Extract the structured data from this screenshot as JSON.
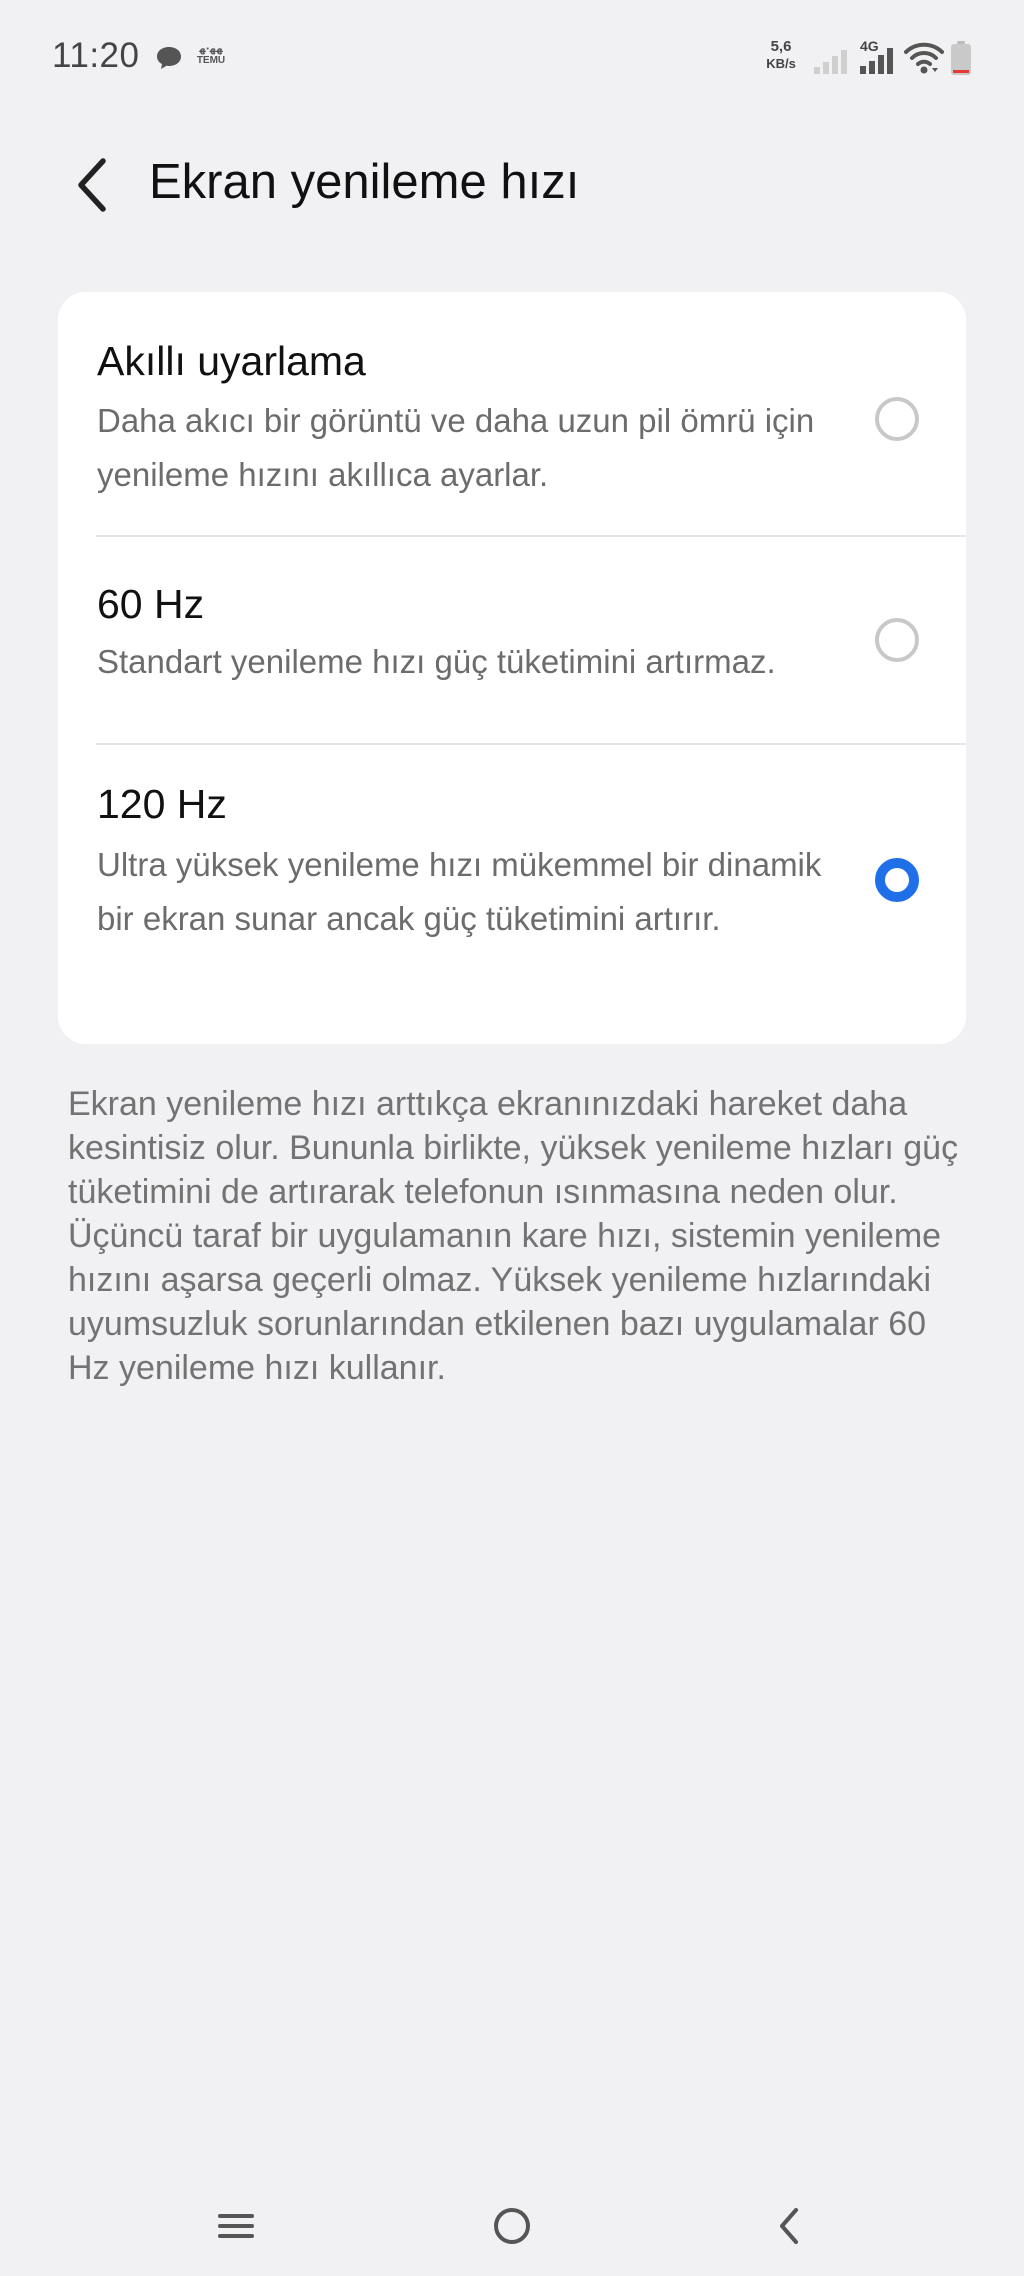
{
  "status_bar": {
    "time": "11:20",
    "net_speed_value": "5,6",
    "net_speed_unit": "KB/s",
    "network_type": "4G",
    "temu_line1": "ﻬﻬ⋅ﻬ",
    "temu_line2": "TEMU",
    "icons": [
      "chat-bubble-icon",
      "temu-icon",
      "signal-sim1-icon",
      "signal-sim2-icon",
      "wifi-icon",
      "battery-low-icon"
    ]
  },
  "header": {
    "title": "Ekran yenileme hızı",
    "back_icon": "chevron-left-icon"
  },
  "options": [
    {
      "title": "Akıllı uyarlama",
      "description": "Daha akıcı bir görüntü ve daha uzun pil ömrü için yenileme hızını akıllıca ayarlar.",
      "selected": false
    },
    {
      "title": "60 Hz",
      "description": "Standart yenileme hızı güç tüketimini artırmaz.",
      "selected": false
    },
    {
      "title": "120 Hz",
      "description": "Ultra yüksek yenileme hızı mükemmel bir dinamik bir ekran sunar ancak güç tüketimini artırır.",
      "selected": true
    }
  ],
  "info_text": "Ekran yenileme hızı arttıkça ekranınızdaki hareket daha kesintisiz olur. Bununla birlikte, yüksek yenileme hızları güç tüketimini de artırarak telefonun ısınmasına neden olur. Üçüncü taraf bir uygulamanın kare hızı, sistemin yenileme hızını aşarsa geçerli olmaz. Yüksek yenileme hızlarındaki uyumsuzluk sorunlarından etkilenen bazı uygulamalar 60 Hz yenileme hızı kullanır.",
  "nav_bar": {
    "icons": [
      "recent-apps-icon",
      "home-icon",
      "back-icon"
    ]
  },
  "colors": {
    "accent": "#1f6fe8",
    "background": "#f1f1f4",
    "card": "#ffffff",
    "battery_low": "#e53935"
  }
}
